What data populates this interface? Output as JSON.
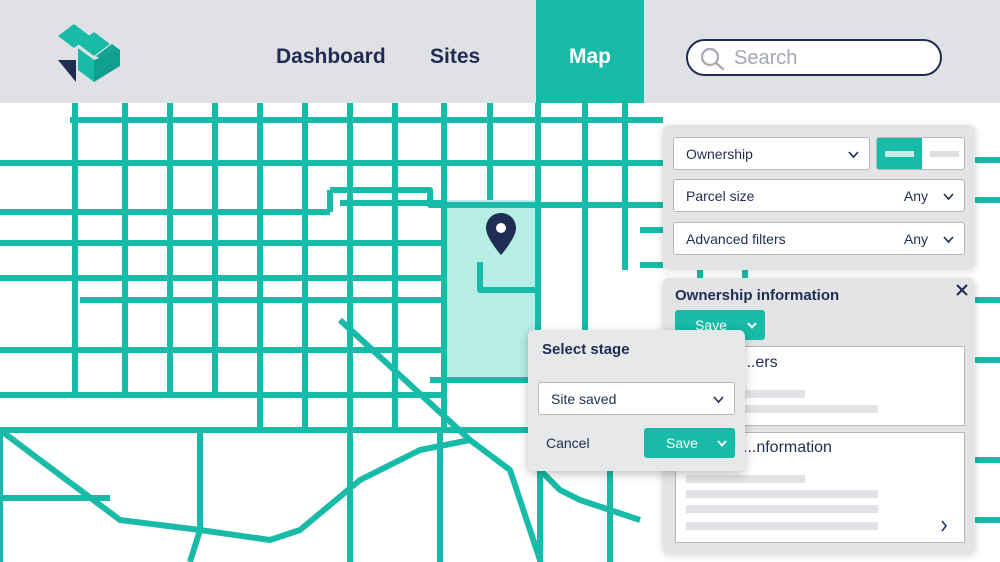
{
  "nav": {
    "dashboard": "Dashboard",
    "sites": "Sites",
    "map": "Map",
    "search_placeholder": "Search"
  },
  "filters": {
    "ownership_label": "Ownership",
    "parcel_size_label": "Parcel size",
    "parcel_size_value": "Any",
    "advanced_label": "Advanced filters",
    "advanced_value": "Any"
  },
  "ownership_panel": {
    "title": "Ownership information",
    "save_label": "Save",
    "section1_title": "...ers",
    "section2_title": "...nformation"
  },
  "stage_modal": {
    "title": "Select stage",
    "selected_stage": "Site saved",
    "cancel_label": "Cancel",
    "save_label": "Save"
  },
  "colors": {
    "brand": "#18bba7",
    "navy": "#1f2d52",
    "highlight": "#b6ede5",
    "panel": "#e3e4e6"
  },
  "icons": {
    "logo": "logo-icon",
    "search": "search-icon",
    "pin": "map-pin-icon",
    "chevron": "chevron-down-icon",
    "close": "close-icon"
  }
}
